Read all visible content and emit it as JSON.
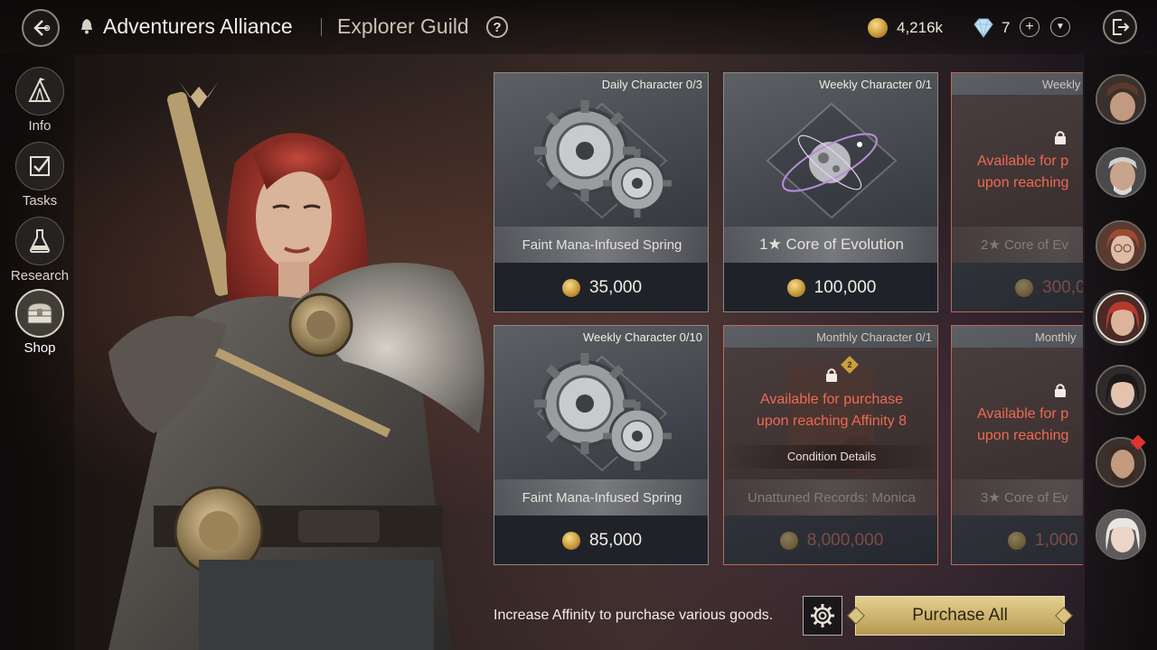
{
  "header": {
    "guild_name": "Adventurers Alliance",
    "sub_title": "Explorer Guild",
    "help_label": "?",
    "gold_amount": "4,216k",
    "gem_amount": "7",
    "plus_label": "+",
    "dropdown_label": "▼"
  },
  "sidebar": {
    "items": [
      {
        "label": "Info",
        "icon": "tent-icon"
      },
      {
        "label": "Tasks",
        "icon": "checklist-icon"
      },
      {
        "label": "Research",
        "icon": "flask-icon"
      },
      {
        "label": "Shop",
        "icon": "chest-icon",
        "active": true
      }
    ]
  },
  "shop": {
    "cards": [
      {
        "header": "Daily Character 0/3",
        "name": "Faint Mana-Infused Spring",
        "price": "35,000",
        "locked": false
      },
      {
        "header": "Weekly Character 0/1",
        "name": "1★ Core of Evolution",
        "price": "100,000",
        "locked": false
      },
      {
        "header": "Weekly",
        "name": "2★ Core of Ev",
        "price": "300,0",
        "locked": true,
        "lock_text_1": "Available for p",
        "lock_text_2": "upon reaching"
      },
      {
        "header": "Weekly Character 0/10",
        "name": "Faint Mana-Infused Spring",
        "price": "85,000",
        "locked": false
      },
      {
        "header": "Monthly Character 0/1",
        "name": "Unattuned Records: Monica",
        "price": "8,000,000",
        "locked": true,
        "lock_text_1": "Available for purchase",
        "lock_text_2": "upon reaching Affinity 8",
        "condition": "Condition Details",
        "badge": "2"
      },
      {
        "header": "Monthly",
        "name": "3★ Core of Ev",
        "price": "1,000",
        "locked": true,
        "lock_text_1": "Available for p",
        "lock_text_2": "upon reaching"
      }
    ]
  },
  "footer": {
    "hint": "Increase Affinity to purchase various goods.",
    "purchase_all": "Purchase All"
  },
  "colors": {
    "accent_gold": "#cdb36b",
    "locked_red": "#ef6a52",
    "notification_red": "#e0322e"
  }
}
